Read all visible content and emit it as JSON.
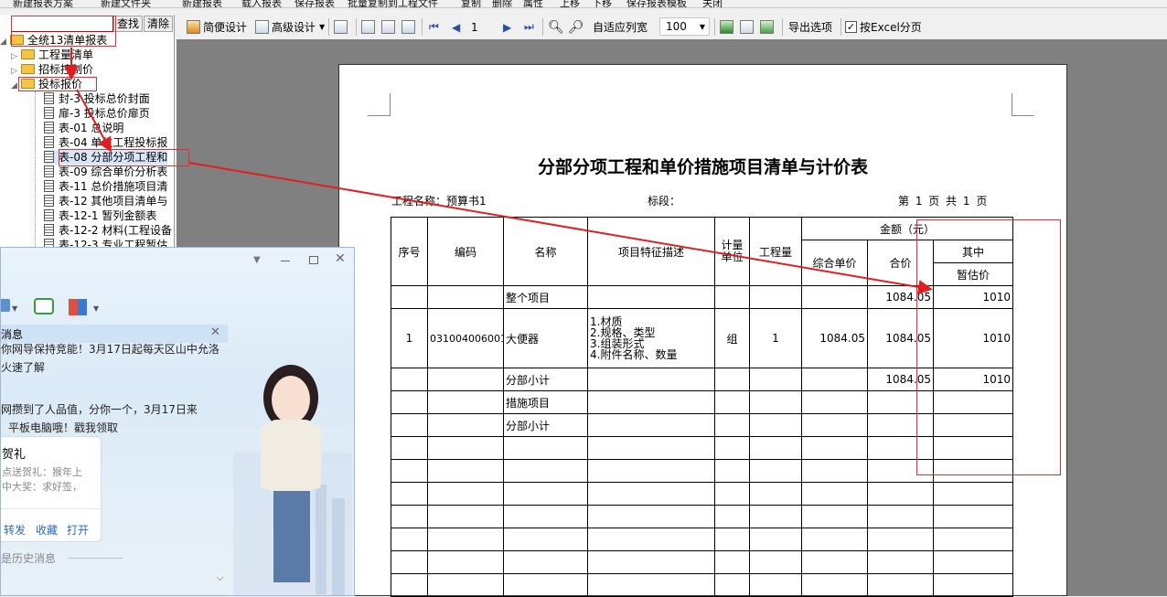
{
  "top_menu": [
    "新建报表方案",
    "新建文件夹",
    "新建报表",
    "载入报表",
    "保存报表",
    "批量复制到工程文件",
    "复制",
    "删除",
    "属性",
    "上移",
    "下移",
    "保存报表模板",
    "关闭"
  ],
  "toolbar": {
    "simple_design": "简便设计",
    "advanced_design": "高级设计",
    "page_value": "1",
    "fit_width": "自适应列宽",
    "zoom_value": "100",
    "export_options": "导出选项",
    "excel_paging": "按Excel分页"
  },
  "left_panel": {
    "find_button": "查找",
    "clear_button": "清除",
    "root": "全统13清单报表",
    "folders": [
      "工程量清单",
      "招标控制价",
      "投标报价"
    ],
    "reports": [
      "封-3 投标总价封面",
      "扉-3 投标总价扉页",
      "表-01 总说明",
      "表-04 单位工程投标报",
      "表-08 分部分项工程和",
      "表-09 综合单价分析表",
      "表-11 总价措施项目清",
      "表-12 其他项目清单与",
      "表-12-1 暂列金额表",
      "表-12-2 材料(工程设备",
      "表-12-3 专业工程暂估"
    ]
  },
  "report": {
    "title": "分部分项工程和单价措施项目清单与计价表",
    "project_label": "工程名称：预算书1",
    "section_label": "标段：",
    "page_info": "第 1 页 共 1 页",
    "headers": {
      "seq": "序号",
      "code": "编码",
      "name": "名称",
      "features": "项目特征描述",
      "unit": "计量单位",
      "quantity": "工程量",
      "amount": "金额（元）",
      "unit_price": "综合单价",
      "total": "合价",
      "among": "其中",
      "estimate": "暂估价"
    },
    "rows": [
      {
        "seq": "",
        "code": "",
        "name": "整个项目",
        "features": "",
        "unit": "",
        "qty": "",
        "unit_price": "",
        "total": "1084.05",
        "estimate": "1010"
      },
      {
        "seq": "1",
        "code": "031004006001",
        "name": "大便器",
        "features": "1.材质\n2.规格、类型\n3.组装形式\n4.附件名称、数量",
        "unit": "组",
        "qty": "1",
        "unit_price": "1084.05",
        "total": "1084.05",
        "estimate": "1010"
      },
      {
        "seq": "",
        "code": "",
        "name": "分部小计",
        "features": "",
        "unit": "",
        "qty": "",
        "unit_price": "",
        "total": "1084.05",
        "estimate": "1010"
      },
      {
        "seq": "",
        "code": "",
        "name": "措施项目",
        "features": "",
        "unit": "",
        "qty": "",
        "unit_price": "",
        "total": "",
        "estimate": ""
      },
      {
        "seq": "",
        "code": "",
        "name": "分部小计",
        "features": "",
        "unit": "",
        "qty": "",
        "unit_price": "",
        "total": "",
        "estimate": ""
      }
    ]
  },
  "chat_popup": {
    "header": "消息",
    "lines": [
      "你网导保持竞能！3月17日起每天区山中允洛",
      "火速了解",
      "网攒到了人品值，分你一个，3月17日来",
      "平板电脑哦！戳我领取"
    ],
    "card_title": "贺礼",
    "card_lines": [
      "点送贺礼：猴年上",
      "中大奖：求好签，"
    ],
    "actions": [
      "转发",
      "收藏",
      "打开"
    ],
    "history": "是历史消息"
  },
  "colors": {
    "annotation_red": "#e02020",
    "viewer_bg": "#808080",
    "folder_yellow": "#f4c542"
  }
}
